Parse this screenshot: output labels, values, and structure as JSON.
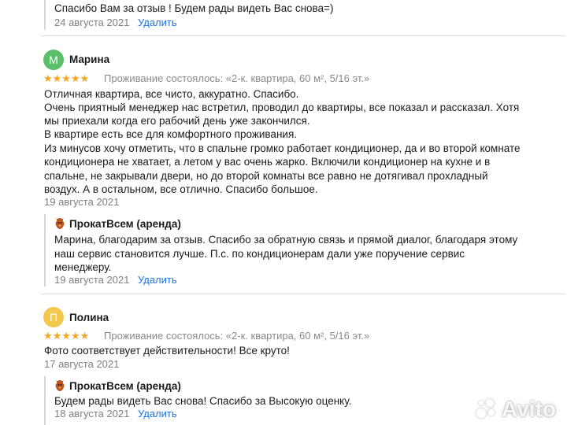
{
  "top_reply": {
    "text": "Спасибо Вам за отзыв ! Будем рады видеть Вас снова=)",
    "date": "24 августа 2021",
    "delete_label": "Удалить"
  },
  "reviews": [
    {
      "avatar_letter": "М",
      "avatar_color": "#5bbf6a",
      "author": "Марина",
      "stars": "★★★★★",
      "meta": "Проживание состоялось: «2-к. квартира, 60 м², 5/16 эт.»",
      "lines": [
        "Отличная квартира, все чисто, аккуратно. Спасибо.",
        "Очень приятный менеджер нас встретил, проводил до квартиры, все показал и рассказал. Хотя",
        "мы приехали когда его рабочий день уже закончился.",
        "В квартире есть все для комфортного проживания.",
        "Из минусов хочу отметить, что в спальне громко работает кондиционер, да и во второй комнате",
        "кондиционера не хватает, а летом у вас очень жарко. Включили кондиционер на кухне и в",
        "спальне, не закрывали двери, но до второй комнаты все равно не дотягивал прохладный",
        "воздух. А в остальном, все отлично. Спасибо большое."
      ],
      "date": "19 августа 2021",
      "reply": {
        "business": "ПрокатВсем (аренда)",
        "lines": [
          "Марина, благодарим за отзыв. Спасибо за обратную связь и прямой диалог, благодаря этому",
          "наш сервис становится лучше. П.с. по кондиционерам дали уже поручение сервис",
          "менеджеру."
        ],
        "date": "19 августа 2021",
        "delete_label": "Удалить"
      }
    },
    {
      "avatar_letter": "П",
      "avatar_color": "#f2c94c",
      "author": "Полина",
      "stars": "★★★★★",
      "meta": "Проживание состоялось: «2-к. квартира, 60 м², 5/16 эт.»",
      "lines": [
        "Фото соответствует действительности! Все круто!"
      ],
      "date": "17 августа 2021",
      "reply": {
        "business": "ПрокатВсем (аренда)",
        "lines": [
          "Будем рады видеть Вас снова! Спасибо за Высокую оценку."
        ],
        "date": "18 августа 2021",
        "delete_label": "Удалить"
      }
    }
  ],
  "watermark": {
    "text": "Avito"
  },
  "colors": {
    "star": "#f5a623",
    "link": "#1a73e8",
    "muted": "#7f7f7f"
  }
}
